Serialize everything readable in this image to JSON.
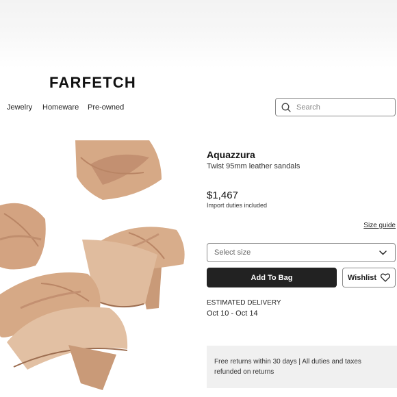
{
  "header": {
    "logo": "FARFETCH",
    "nav": [
      {
        "label": "Jewelry"
      },
      {
        "label": "Homeware"
      },
      {
        "label": "Pre-owned"
      }
    ],
    "search": {
      "placeholder": "Search",
      "icon": "search-icon"
    }
  },
  "product": {
    "brand": "Aquazzura",
    "name": "Twist 95mm leather sandals",
    "price": "$1,467",
    "duties_note": "Import duties included",
    "image_alt": "sandals-image",
    "colors": {
      "leather": "#d6a986",
      "leather_shadow": "#b98565",
      "bag_button": "#222222"
    }
  },
  "actions": {
    "size_guide": "Size guide",
    "select_size": "Select size",
    "add_to_bag": "Add To Bag",
    "wishlist": "Wishlist"
  },
  "delivery": {
    "label": "ESTIMATED DELIVERY",
    "dates": "Oct 10 - Oct 14"
  },
  "returns": {
    "text": "Free returns within 30 days | All duties and taxes refunded on returns"
  }
}
